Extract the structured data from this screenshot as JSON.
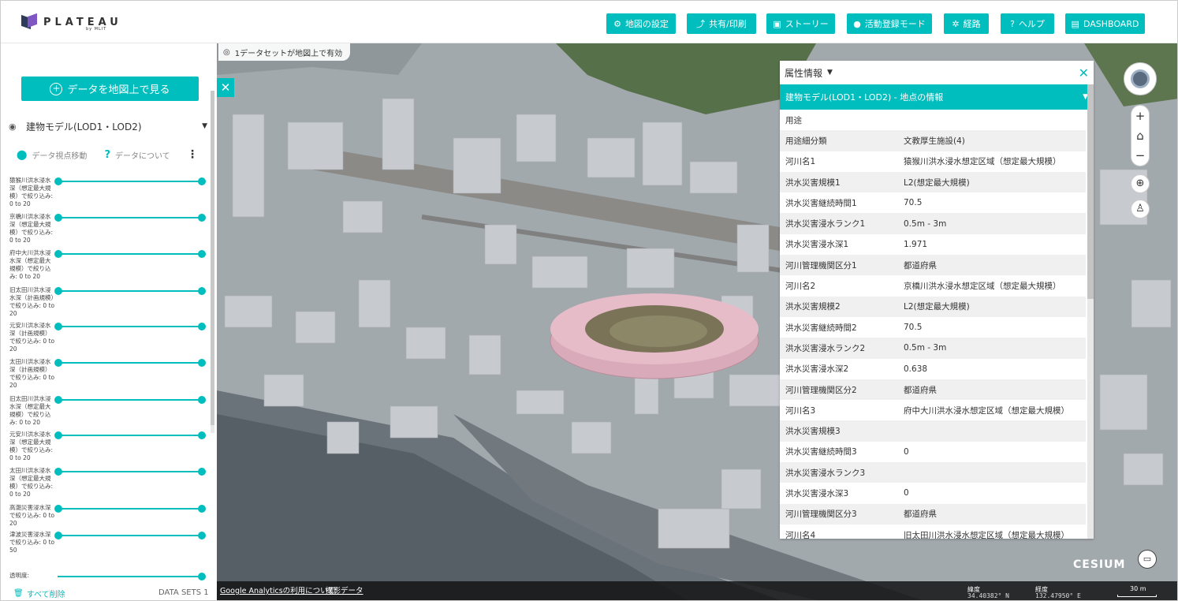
{
  "header": {
    "logo_text": "PLATEAU",
    "logo_sub": "by MLIT",
    "buttons": [
      {
        "label": "地図の設定",
        "icon": "sliders-icon"
      },
      {
        "label": "共有/印刷",
        "icon": "share-icon"
      },
      {
        "label": "ストーリー",
        "icon": "story-icon"
      },
      {
        "label": "活動登録モード",
        "icon": "users-icon"
      },
      {
        "label": "経路",
        "icon": "route-icon"
      },
      {
        "label": "ヘルプ",
        "icon": "help-icon"
      },
      {
        "label": "DASHBOARD",
        "icon": "book-icon"
      }
    ]
  },
  "left_panel": {
    "view_button": "データを地図上で見る",
    "dataset_name": "建物モデル(LOD1・LOD2)",
    "action_move": "データ視点移動",
    "action_about": "データについて",
    "filters": [
      {
        "label": "猿猴川洪水浸水深（想定最大規模）で絞り込み: 0 to 20",
        "range": [
          0,
          20
        ]
      },
      {
        "label": "京橋川洪水浸水深（想定最大規模）で絞り込み: 0 to 20",
        "range": [
          0,
          20
        ]
      },
      {
        "label": "府中大川洪水浸水深（想定最大規模）で絞り込み: 0 to 20",
        "range": [
          0,
          20
        ]
      },
      {
        "label": "旧太田川洪水浸水深（計画規模）で絞り込み: 0 to 20",
        "range": [
          0,
          20
        ]
      },
      {
        "label": "元安川洪水浸水深（計画規模）で絞り込み: 0 to 20",
        "range": [
          0,
          20
        ]
      },
      {
        "label": "太田川洪水浸水深（計画規模）で絞り込み: 0 to 20",
        "range": [
          0,
          20
        ]
      },
      {
        "label": "旧太田川洪水浸水深（想定最大規模）で絞り込み: 0 to 20",
        "range": [
          0,
          20
        ]
      },
      {
        "label": "元安川洪水浸水深（想定最大規模）で絞り込み: 0 to 20",
        "range": [
          0,
          20
        ]
      },
      {
        "label": "太田川洪水浸水深（想定最大規模）で絞り込み: 0 to 20",
        "range": [
          0,
          20
        ]
      },
      {
        "label": "高潮災害浸水深で絞り込み: 0 to 20",
        "range": [
          0,
          20
        ]
      },
      {
        "label": "津波災害浸水深で絞り込み: 0 to 50",
        "range": [
          0,
          50
        ]
      }
    ],
    "opacity_label": "透明度:",
    "remove_all": "すべて削除",
    "datasets_count": "DATA SETS 1"
  },
  "map": {
    "dataset_notice": "1データセットが地図上で有効",
    "cesium_logo": "CESIUM",
    "footer_links": [
      "Google Analyticsの利用について",
      "撮影データ"
    ],
    "lat_label": "緯度",
    "lat_value": "34.40382° N",
    "lon_label": "経度",
    "lon_value": "132.47950° E",
    "scale_label": "30 m"
  },
  "properties": {
    "title": "属性情報",
    "subtitle": "建物モデル(LOD1・LOD2) - 地点の情報",
    "rows": [
      {
        "key": "用途",
        "value": ""
      },
      {
        "key": "用途細分類",
        "value": "文教厚生施設(4)"
      },
      {
        "key": "河川名1",
        "value": "猿猴川洪水浸水想定区域（想定最大規模）"
      },
      {
        "key": "洪水災害規模1",
        "value": "L2(想定最大規模)"
      },
      {
        "key": "洪水災害継続時間1",
        "value": "70.5"
      },
      {
        "key": "洪水災害浸水ランク1",
        "value": "0.5m - 3m"
      },
      {
        "key": "洪水災害浸水深1",
        "value": "1.971"
      },
      {
        "key": "河川管理機関区分1",
        "value": "都道府県"
      },
      {
        "key": "河川名2",
        "value": "京橋川洪水浸水想定区域（想定最大規模）"
      },
      {
        "key": "洪水災害規模2",
        "value": "L2(想定最大規模)"
      },
      {
        "key": "洪水災害継続時間2",
        "value": "70.5"
      },
      {
        "key": "洪水災害浸水ランク2",
        "value": "0.5m - 3m"
      },
      {
        "key": "洪水災害浸水深2",
        "value": "0.638"
      },
      {
        "key": "河川管理機関区分2",
        "value": "都道府県"
      },
      {
        "key": "河川名3",
        "value": "府中大川洪水浸水想定区域（想定最大規模）"
      },
      {
        "key": "洪水災害規模3",
        "value": ""
      },
      {
        "key": "洪水災害継続時間3",
        "value": "0"
      },
      {
        "key": "洪水災害浸水ランク3",
        "value": ""
      },
      {
        "key": "洪水災害浸水深3",
        "value": "0"
      },
      {
        "key": "河川管理機関区分3",
        "value": "都道府県"
      },
      {
        "key": "河川名4",
        "value": "旧太田川洪水浸水想定区域（想定最大規模）"
      }
    ]
  },
  "colors": {
    "accent": "#00bebe",
    "selected_building": "#d8a8b8"
  }
}
